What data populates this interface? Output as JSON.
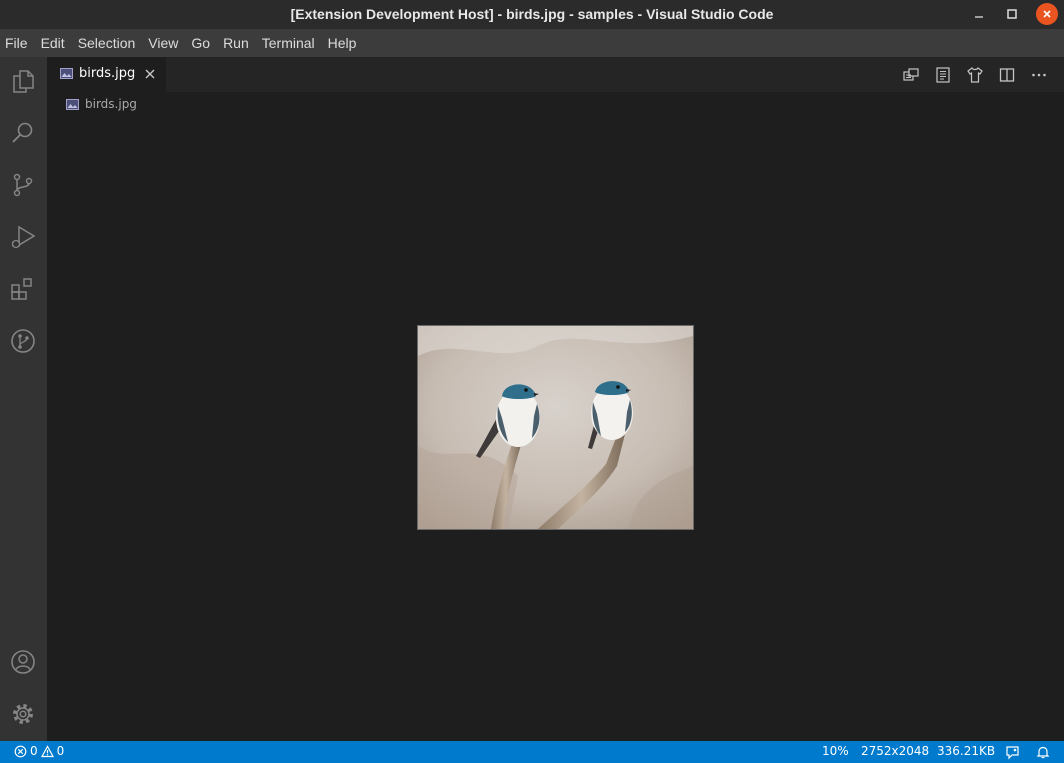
{
  "window": {
    "title": "[Extension Development Host] - birds.jpg - samples - Visual Studio Code",
    "controls": [
      "minimize-icon",
      "maximize-icon",
      "close-icon"
    ]
  },
  "menu": {
    "items": [
      "File",
      "Edit",
      "Selection",
      "View",
      "Go",
      "Run",
      "Terminal",
      "Help"
    ]
  },
  "activity_bar": {
    "top": [
      "files-icon",
      "search-icon",
      "source-control-icon",
      "run-debug-icon",
      "extensions-icon",
      "git-graph-icon"
    ],
    "bottom": [
      "account-icon",
      "settings-gear-icon"
    ]
  },
  "tabs": [
    {
      "label": "birds.jpg",
      "icon": "image-file-icon",
      "active": true
    }
  ],
  "editor_actions": [
    "remote-explorer-icon",
    "open-preview-icon",
    "shirt-icon",
    "split-editor-icon",
    "more-actions-icon"
  ],
  "breadcrumb": {
    "label": "birds.jpg",
    "icon": "image-file-icon"
  },
  "status_bar": {
    "errors": "0",
    "warnings": "0",
    "zoom": "10%",
    "dimensions": "2752x2048",
    "file_size": "336.21KB",
    "right_icons": [
      "feedback-icon",
      "bell-icon"
    ]
  },
  "colors": {
    "status_bar": "#007acc",
    "title_bar": "#2b2b2b",
    "menu_bar": "#3c3c3c",
    "activity_bar": "#333333",
    "editor": "#1e1e1e",
    "close_button": "#e95420"
  }
}
